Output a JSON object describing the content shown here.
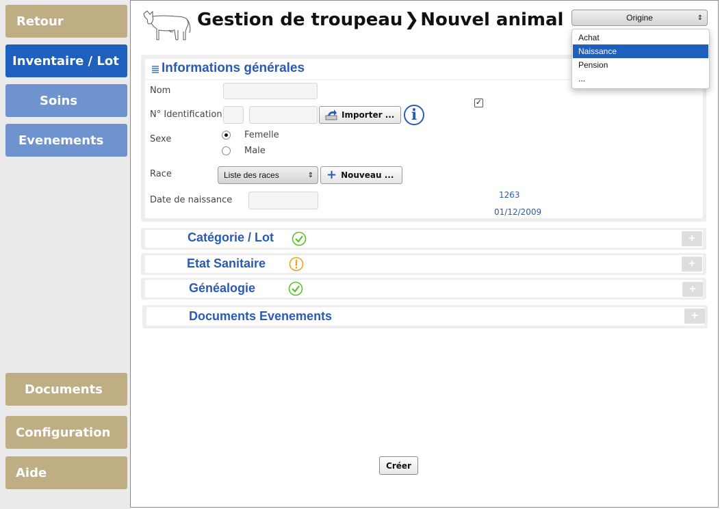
{
  "sidebar": {
    "top": [
      {
        "label": "Retour",
        "style": "tan"
      },
      {
        "label": "Inventaire / Lot",
        "style": "blue-dark"
      },
      {
        "label": "Soins",
        "style": "blue-light"
      },
      {
        "label": "Evenements",
        "style": "blue-light"
      }
    ],
    "bottom": [
      {
        "label": "Documents"
      },
      {
        "label": "Configuration"
      },
      {
        "label": "Aide"
      }
    ]
  },
  "header": {
    "title": "Gestion de troupeau",
    "separator": "❯",
    "subtitle": "Nouvel animal"
  },
  "origin_select": {
    "value": "Origine",
    "options": [
      "Achat",
      "Naissance",
      "Pension",
      "..."
    ],
    "highlighted": "Naissance"
  },
  "general": {
    "title": "Informations générales",
    "labels": {
      "nom": "Nom",
      "identification": "N° Identification",
      "sexe": "Sexe",
      "race": "Race",
      "date": "Date de naissance"
    },
    "sexe_options": [
      {
        "label": "Femelle",
        "selected": true
      },
      {
        "label": "Male",
        "selected": false
      }
    ],
    "import_button": "Importer ...",
    "race_select": "Liste des races",
    "new_button": "Nouveau ...",
    "checkbox_checked": true,
    "values": [
      "1263",
      "01/12/2009"
    ]
  },
  "sections": [
    {
      "title": "Catégorie / Lot",
      "status": "ok"
    },
    {
      "title": "Etat Sanitaire",
      "status": "warning"
    },
    {
      "title": "Généalogie",
      "status": "ok"
    },
    {
      "title": "Documents  Evenements",
      "status": "none"
    }
  ],
  "create_button": "Créer",
  "colors": {
    "tan": "#bfad83",
    "blue_dark": "#1f5fbd",
    "blue_light": "#6f93cf",
    "accent_text": "#2a5ab7",
    "ok": "#5cbf2a",
    "warning": "#e8a21c"
  }
}
